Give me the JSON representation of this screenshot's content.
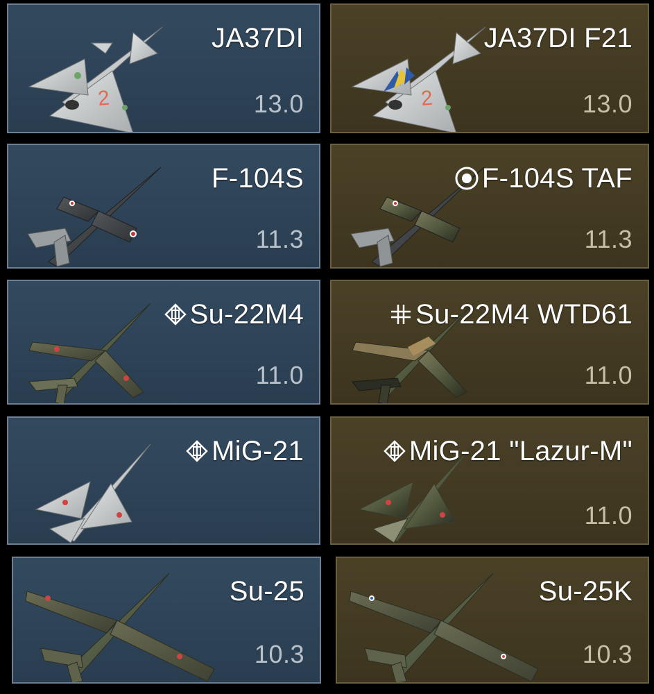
{
  "colors": {
    "tech_tree_card": "#2e4357",
    "premium_card": "#433a22",
    "name_text": "#ffffff",
    "br_text": "#b9c2cb"
  },
  "rows": [
    {
      "left": {
        "name": "JA37DI",
        "br": "13.0",
        "icon": "",
        "plane": "ja37-delta-jet-icon"
      },
      "right": {
        "name": "JA37DI F21",
        "br": "13.0",
        "icon": "",
        "plane": "ja37-delta-jet-icon"
      }
    },
    {
      "left": {
        "name": "F-104S",
        "br": "11.3",
        "icon": "",
        "plane": "f104-jet-icon"
      },
      "right": {
        "name": "F-104S TAF",
        "br": "11.3",
        "icon": "italy-roundel-icon",
        "plane": "f104-jet-icon"
      }
    },
    {
      "left": {
        "name": "Su-22M4",
        "br": "11.0",
        "icon": "warsaw-pact-icon",
        "plane": "su22-swingwing-jet-icon"
      },
      "right": {
        "name": "Su-22M4 WTD61",
        "br": "11.0",
        "icon": "bundeswehr-cross-icon",
        "plane": "su22-swingwing-jet-icon"
      }
    },
    {
      "left": {
        "name": "MiG-21",
        "br": "",
        "icon": "warsaw-pact-icon",
        "plane": "mig21-delta-jet-icon"
      },
      "right": {
        "name": "MiG-21 \"Lazur-M\"",
        "br": "11.0",
        "icon": "warsaw-pact-icon",
        "plane": "mig21-delta-jet-icon"
      }
    },
    {
      "left": {
        "name": "Su-25",
        "br": "10.3",
        "icon": "",
        "plane": "su25-attack-jet-icon"
      },
      "right": {
        "name": "Su-25K",
        "br": "10.3",
        "icon": "",
        "plane": "su25-attack-jet-icon"
      }
    }
  ]
}
